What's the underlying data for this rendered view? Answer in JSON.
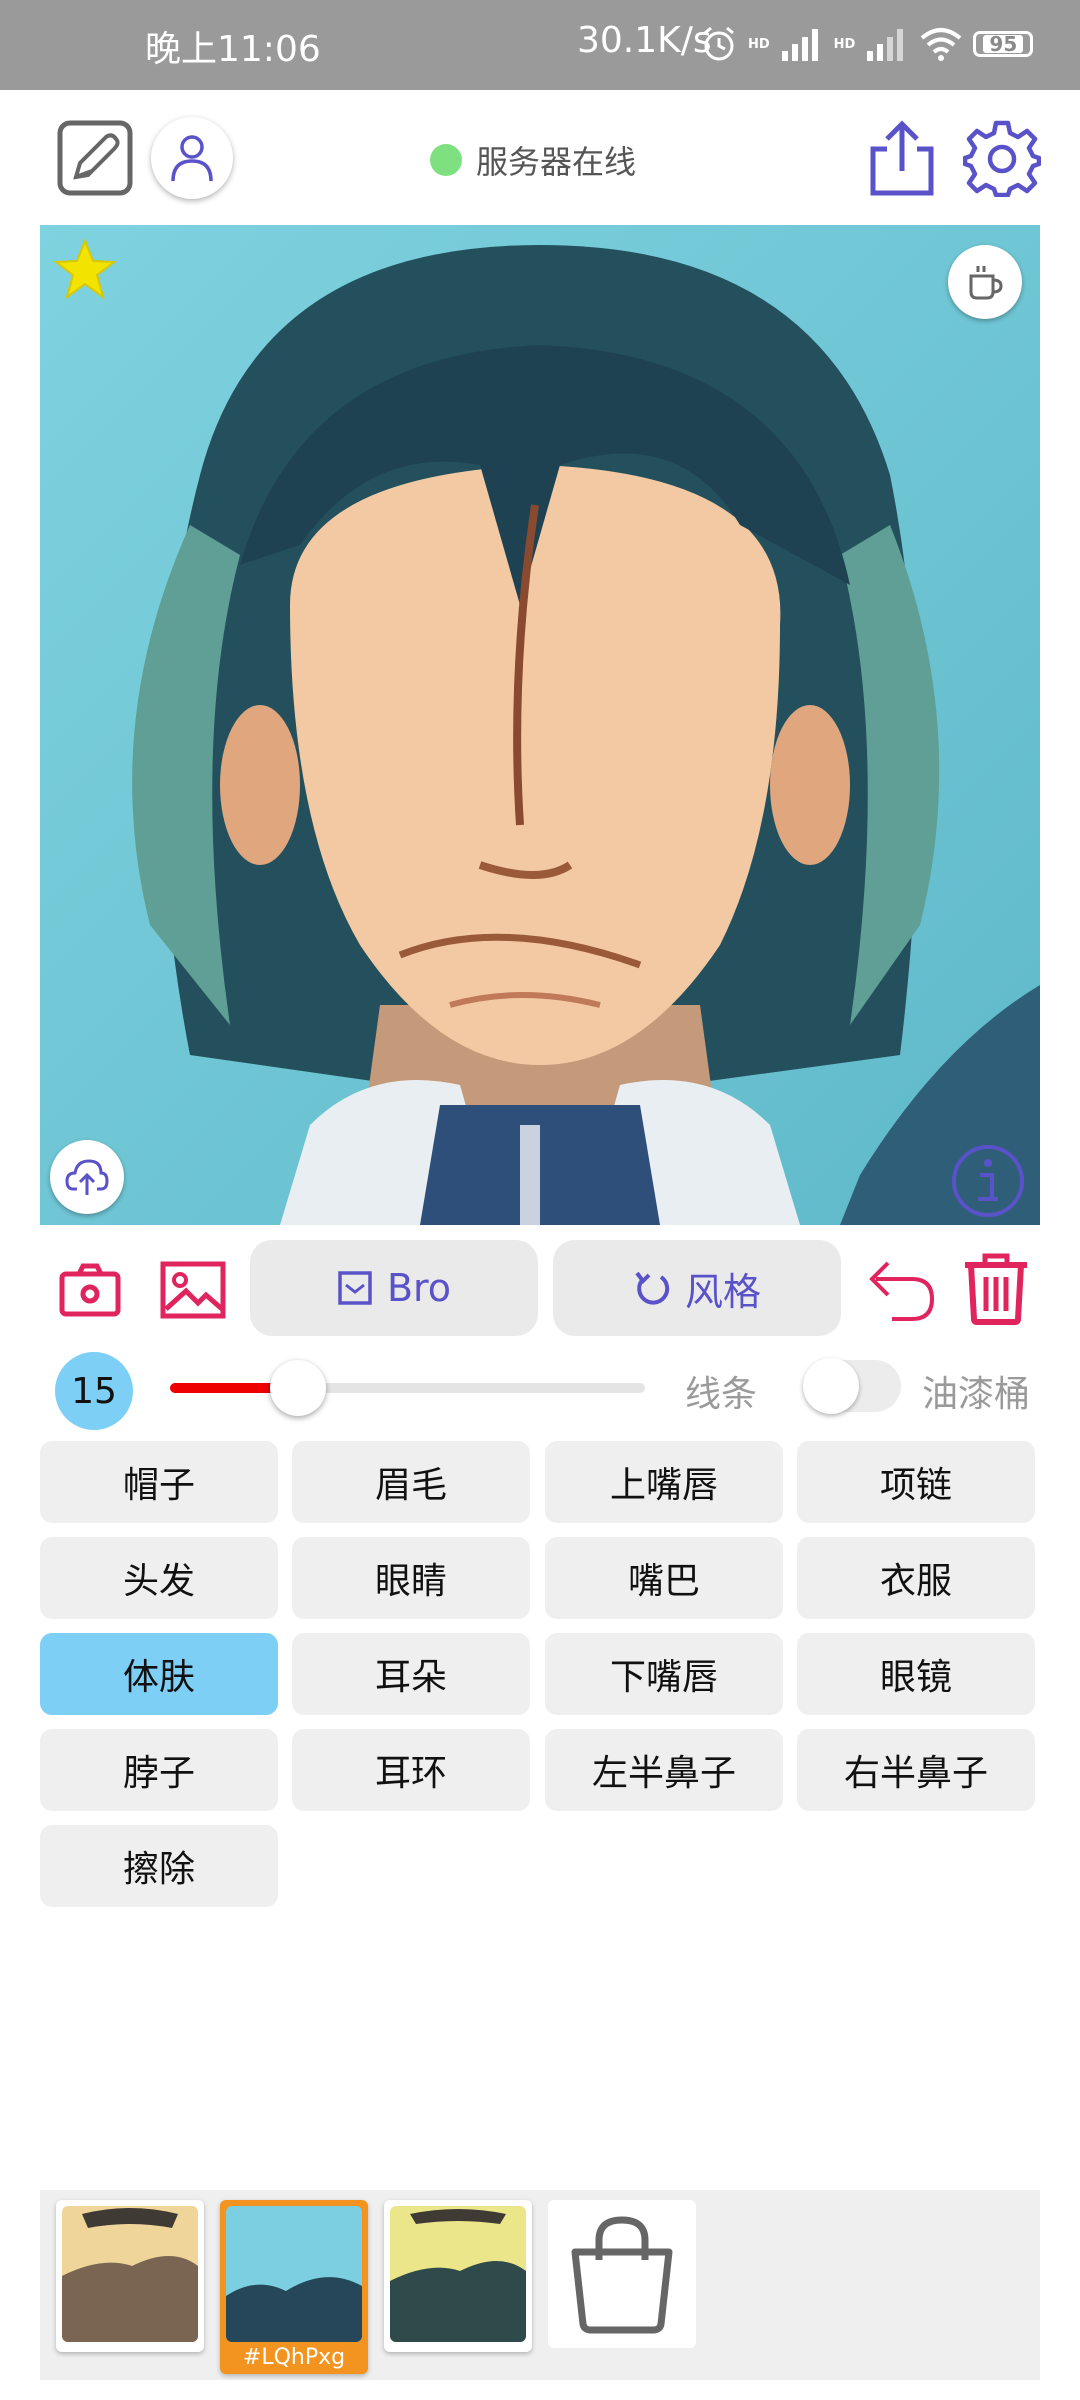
{
  "status_bar": {
    "time": "晚上11:06",
    "net_speed": "30.1K/s",
    "battery": "95",
    "hd_1": "HD",
    "hd_2": "HD"
  },
  "header": {
    "server_status": "服务器在线",
    "server_status_color": "#7fe07f",
    "icons": [
      "edit-icon",
      "user-icon",
      "share-icon",
      "settings-icon"
    ]
  },
  "canvas": {
    "icons": [
      "star-icon",
      "coffee-icon",
      "cloud-upload-icon",
      "info-icon"
    ]
  },
  "toolbar": {
    "bro_label": "Bro",
    "style_label": "风格",
    "icons": [
      "camera-icon",
      "image-icon",
      "checkbox-icon",
      "redo-icon",
      "undo-icon",
      "trash-icon"
    ],
    "accent_color": "#e0245e",
    "primary_color": "#5a52c8"
  },
  "brush": {
    "size": "15",
    "slider_value": 15,
    "line_label": "线条",
    "bucket_label": "油漆桶",
    "bucket_enabled": false
  },
  "labels": {
    "row1": [
      "帽子",
      "眉毛",
      "上嘴唇",
      "项链"
    ],
    "row2": [
      "头发",
      "眼睛",
      "嘴巴",
      "衣服"
    ],
    "row3": [
      "体肤",
      "耳朵",
      "下嘴唇",
      "眼镜"
    ],
    "row4": [
      "脖子",
      "耳环",
      "左半鼻子",
      "右半鼻子"
    ],
    "row5": [
      "擦除"
    ],
    "selected": "体肤"
  },
  "tray": {
    "active_id": "#LQhPxg",
    "icons": [
      "bag-icon"
    ]
  }
}
